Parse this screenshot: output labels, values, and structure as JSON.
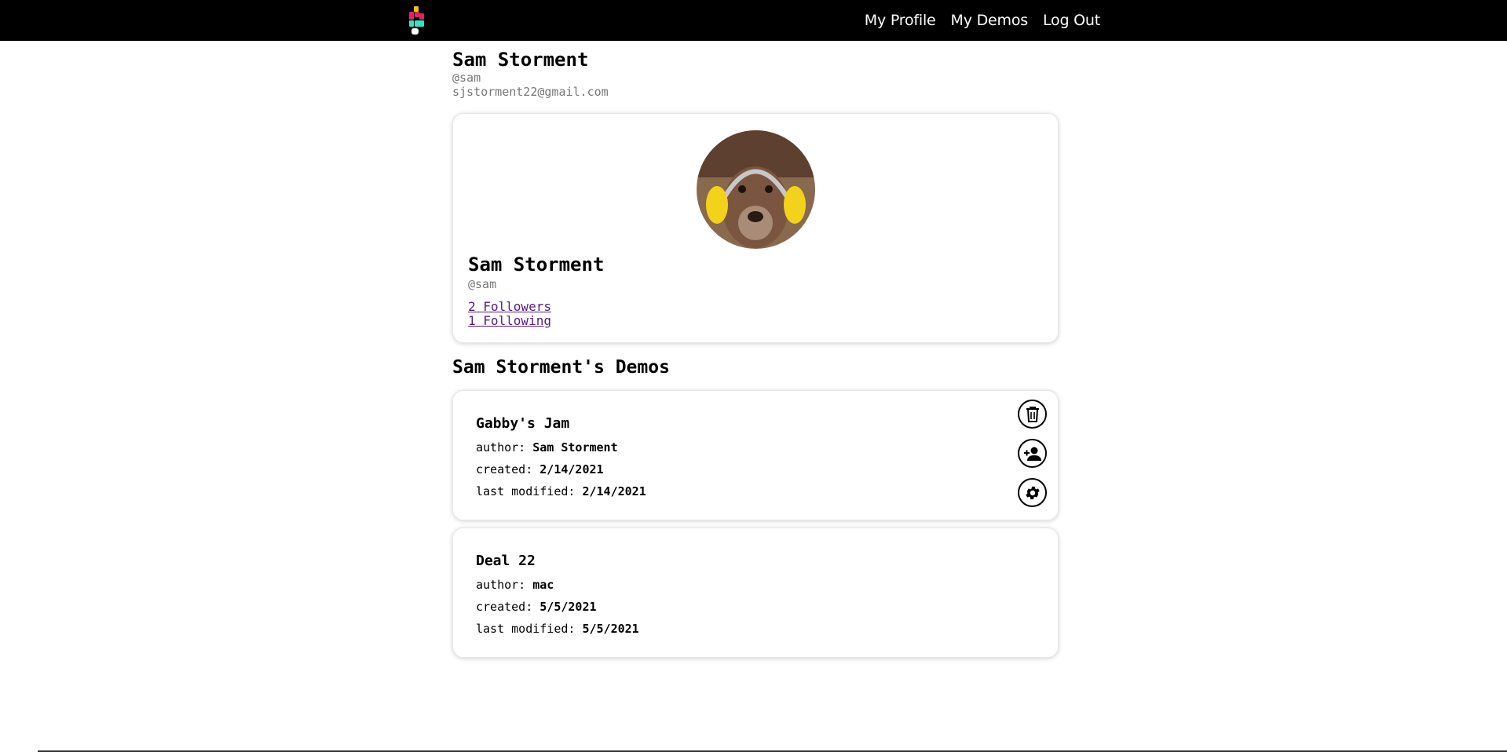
{
  "nav": {
    "links": [
      "My Profile",
      "My Demos",
      "Log Out"
    ]
  },
  "header": {
    "name": "Sam Storment",
    "handle": "@sam",
    "email": "sjstorment22@gmail.com"
  },
  "profile": {
    "name": "Sam Storment",
    "handle": "@sam",
    "followers": "2 Followers",
    "following": "1 Following"
  },
  "demos_title": "Sam Storment's Demos",
  "demos": [
    {
      "title": "Gabby's Jam",
      "author_label": "author:",
      "author": "Sam Storment",
      "created_label": "created:",
      "created": "2/14/2021",
      "modified_label": "last modified:",
      "modified": "2/14/2021",
      "actions": [
        "trash-icon",
        "add-person-icon",
        "gear-icon"
      ]
    },
    {
      "title": "Deal 22",
      "author_label": "author:",
      "author": "mac",
      "created_label": "created:",
      "created": "5/5/2021",
      "modified_label": "last modified:",
      "modified": "5/5/2021"
    }
  ],
  "colors": {
    "navbar": "#000000",
    "link": "#551a8b",
    "muted": "#777777"
  }
}
